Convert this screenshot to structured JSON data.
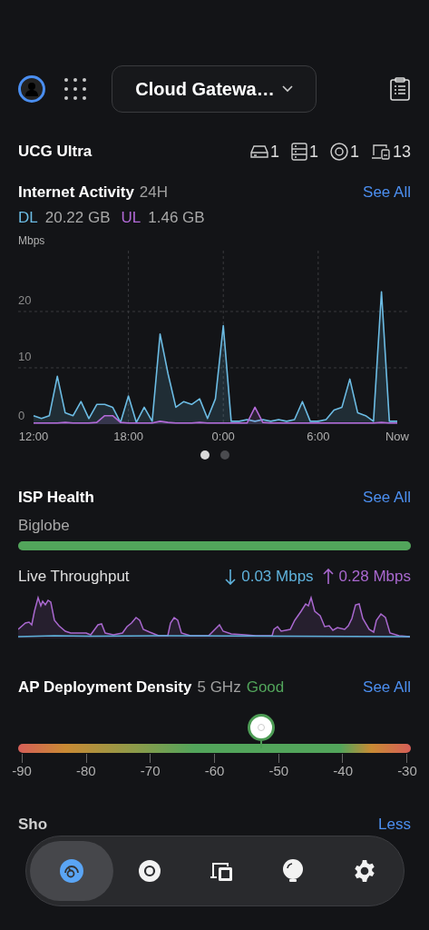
{
  "header": {
    "device_selector": "Cloud Gatewa…"
  },
  "device": {
    "name": "UCG Ultra",
    "stats": [
      {
        "kind": "gateway",
        "count": "1"
      },
      {
        "kind": "switch",
        "count": "1"
      },
      {
        "kind": "ap",
        "count": "1"
      },
      {
        "kind": "clients",
        "count": "13"
      }
    ]
  },
  "internet_activity": {
    "title": "Internet Activity",
    "period": "24H",
    "link": "See All",
    "dl_value": "20.22 GB",
    "ul_value": "1.46 GB",
    "chart_data": {
      "type": "area",
      "grid": true,
      "ylabel": "Mbps",
      "ylim": [
        0,
        30.8
      ],
      "categories": [
        "12:00",
        null,
        null,
        null,
        null,
        null,
        null,
        null,
        null,
        null,
        null,
        null,
        "18:00",
        null,
        null,
        null,
        null,
        null,
        null,
        null,
        null,
        null,
        null,
        null,
        "0:00",
        null,
        null,
        null,
        null,
        null,
        null,
        null,
        null,
        null,
        null,
        null,
        "6:00",
        null,
        null,
        null,
        null,
        null,
        null,
        null,
        null,
        null,
        "Now"
      ],
      "series": [
        {
          "name": "DL",
          "color": "#6cbce4",
          "values": [
            1.5,
            1,
            1.5,
            8.5,
            2,
            1.5,
            4,
            1,
            3.5,
            3.5,
            3,
            0.3,
            5,
            0.3,
            3,
            0.5,
            16,
            9,
            3,
            4,
            3.5,
            4.5,
            1,
            4.5,
            17.5,
            0.5,
            0.5,
            0.8,
            0.5,
            0.8,
            0.5,
            0.8,
            0.5,
            0.8,
            4,
            0.5,
            0.5,
            0.8,
            2.5,
            3,
            8,
            2,
            1.5,
            0.5,
            23.5,
            0.5,
            0.5
          ]
        },
        {
          "name": "UL",
          "color": "#b36ad8",
          "values": [
            0.2,
            0.2,
            0.2,
            0.2,
            0.3,
            0.2,
            0.2,
            0.2,
            0.3,
            1.5,
            1.5,
            0.3,
            0.2,
            0.2,
            0.2,
            0.2,
            0.5,
            0.3,
            0.2,
            0.2,
            0.2,
            0.3,
            0.2,
            0.2,
            0.2,
            0.2,
            0.2,
            0.2,
            3,
            0.3,
            0.2,
            0.2,
            0.2,
            0.2,
            0.2,
            0.2,
            0.2,
            0.2,
            0.2,
            0.2,
            0.2,
            0.2,
            0.2,
            0.2,
            0.3,
            0.2,
            0.2
          ]
        }
      ],
      "yticks": [
        0,
        10,
        20
      ]
    },
    "pages": [
      {
        "selected": true
      },
      {
        "selected": false
      }
    ]
  },
  "isp_health": {
    "title": "ISP Health",
    "link": "See All",
    "isp": "Biglobe",
    "level": 1,
    "throughput_label": "Live Throughput",
    "down": "0.03 Mbps",
    "up": "0.28 Mbps"
  },
  "ap_density": {
    "title": "AP Deployment Density",
    "band": "5 GHz",
    "rating": "Good",
    "link": "See All",
    "scale": [
      "-90",
      "-80",
      "-70",
      "-60",
      "-50",
      "-40",
      "-30"
    ]
  },
  "shortcuts": {
    "title": "Sho",
    "link": "Less"
  },
  "nav": [
    {
      "kind": "dashboard",
      "selected": true
    },
    {
      "kind": "devices",
      "selected": false
    },
    {
      "kind": "clients",
      "selected": false
    },
    {
      "kind": "insights",
      "selected": false
    },
    {
      "kind": "settings",
      "selected": false
    }
  ]
}
